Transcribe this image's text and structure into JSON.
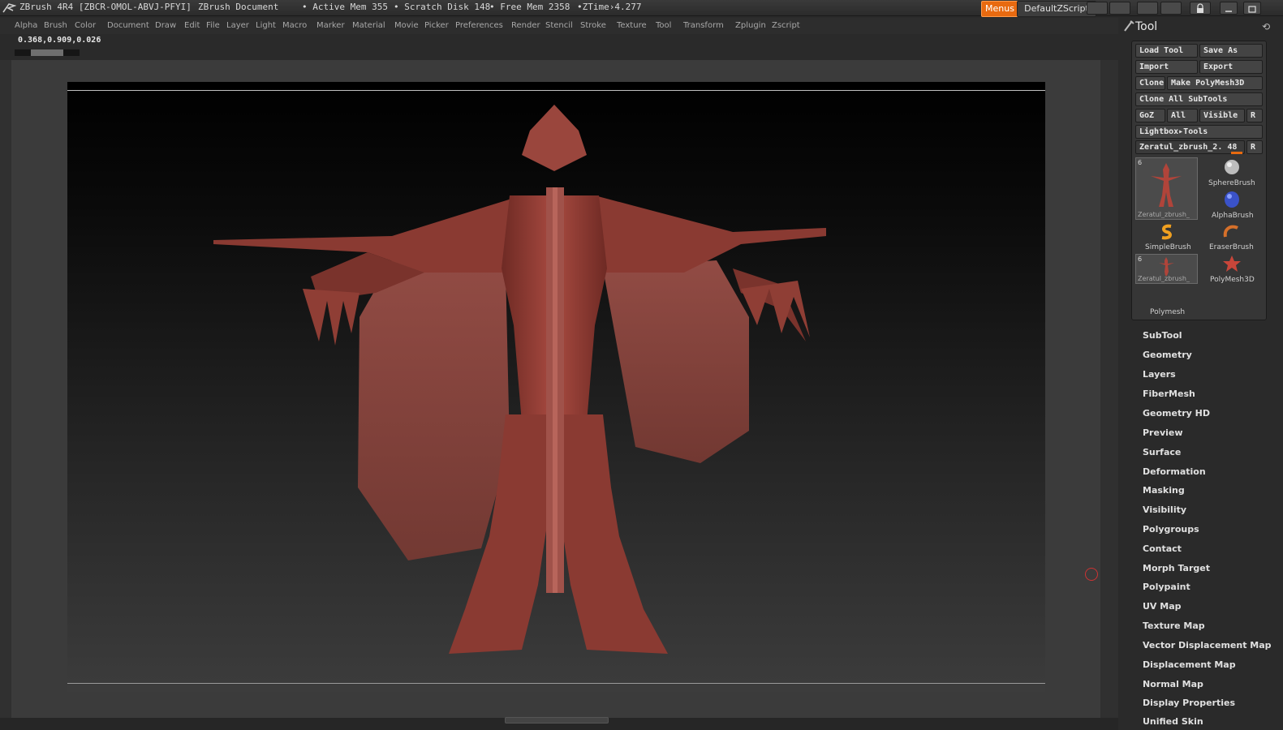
{
  "titlebar": {
    "app": "ZBrush 4R4 [ZBCR-OMOL-ABVJ-PFYI]",
    "document": "ZBrush Document",
    "active_mem": "• Active Mem 355",
    "scratch_disk": "• Scratch Disk 148",
    "free_mem": "• Free Mem 2358",
    "ztime": "•ZTime›4.277",
    "menus_button": "Menus",
    "script_button": "DefaultZScript"
  },
  "menubar": {
    "items": [
      "Alpha",
      "Brush",
      "Color",
      "Document",
      "Draw",
      "Edit",
      "File",
      "Layer",
      "Light",
      "Macro",
      "Marker",
      "Material",
      "Movie",
      "Picker",
      "Preferences",
      "Render",
      "Stencil",
      "Stroke",
      "Texture",
      "Tool",
      "Transform",
      "Zplugin",
      "Zscript"
    ]
  },
  "coords": "0.368,0.909,0.026",
  "slider": {
    "value": 0.5
  },
  "tool_panel": {
    "title": "Tool",
    "buttons": {
      "load_tool": "Load Tool",
      "save_as": "Save As",
      "import": "Import",
      "export": "Export",
      "clone": "Clone",
      "make_polymesh": "Make PolyMesh3D",
      "clone_all": "Clone All SubTools",
      "goz": "GoZ",
      "all": "All",
      "visible": "Visible",
      "r": "R",
      "lightbox_tools": "Lightbox▸Tools",
      "current_tool": "Zeratul_zbrush_2. 48",
      "r2": "R"
    },
    "thumbnails": {
      "zeratul_count": "6",
      "zeratul_caption": "Zeratul_zbrush_",
      "sphere_brush": "SphereBrush",
      "alpha_brush": "AlphaBrush",
      "simple_brush": "SimpleBrush",
      "eraser_brush": "EraserBrush",
      "zeratul2_count": "6",
      "zeratul2_caption": "Zeratul_zbrush_",
      "polymesh3d": "PolyMesh3D",
      "polymesh": "Polymesh"
    },
    "subpalettes": [
      "SubTool",
      "Geometry",
      "Layers",
      "FiberMesh",
      "Geometry HD",
      "Preview",
      "Surface",
      "Deformation",
      "Masking",
      "Visibility",
      "Polygroups",
      "Contact",
      "Morph Target",
      "Polypaint",
      "UV Map",
      "Texture Map",
      "Vector Displacement Map",
      "Displacement Map",
      "Normal Map",
      "Display Properties",
      "Unified Skin"
    ]
  },
  "colors": {
    "accent": "#e86a10",
    "model": "#8a3a32"
  }
}
